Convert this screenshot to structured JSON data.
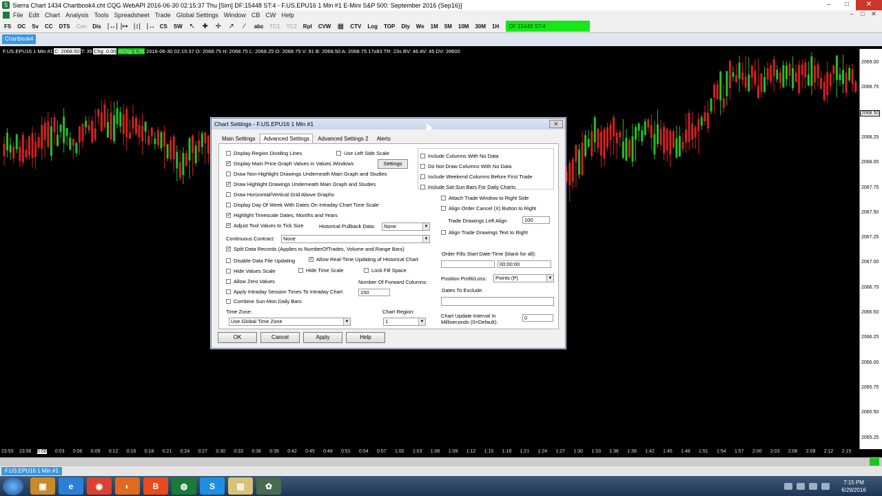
{
  "window": {
    "title": "Sierra Chart 1434 Chartbook4.cht  CQG WebAPI 2016-06-30  02:15:37 Thu [Sim]  DF:15448  ST:4 - F.US.EPU16  1 Min  #1  E-Mini S&P 500: September 2016 (Sep16)]",
    "min": "–",
    "max": "□",
    "close": "✕"
  },
  "menu": [
    "File",
    "Edit",
    "Chart",
    "Analysis",
    "Tools",
    "Spreadsheet",
    "Trade",
    "Global Settings",
    "Window",
    "CB",
    "CW",
    "Help"
  ],
  "mdi_controls": [
    "–",
    "□",
    "✕"
  ],
  "toolbar": {
    "items": [
      "FS",
      "OC",
      "Sv",
      "CC",
      "DTS",
      "Con",
      "Dis"
    ],
    "tools": [
      "|↔|",
      "|↦",
      "|↕|",
      "|↔",
      "CS",
      "SW"
    ],
    "cursors": [
      "↖",
      "✚",
      "✛",
      "↗",
      "⁄"
    ],
    "text_items": [
      "abc",
      "TC1",
      "TC2",
      "Rpl",
      "CVW",
      "▦",
      "CTV",
      "Log",
      "TOP",
      "Dly",
      "We",
      "1M",
      "5M",
      "10M",
      "30M",
      "1H"
    ],
    "status": "DF:15449  ST:4"
  },
  "chartbook_tab": "Chartbook4",
  "chart": {
    "info": {
      "symbol": "F.US.EPU16  1 Min  #1",
      "c_box": "C: 2068.50",
      "t": "T: 39",
      "chg": "Chg: 0.00",
      "pchg": "0Chg: 1.75",
      "rest": "2016-06-30  02:15:37 O: 2068.75  H: 2068.75  L: 2068.25  O: 2068.75  V: 91  B: 2068.50  A: 2068.75  17x83  TR: 23s  BV: 46  AV: 45  DV: 39600"
    },
    "price_labels": [
      "2069.00",
      "2068.75",
      "2068.50",
      "2068.25",
      "2068.00",
      "2067.75",
      "2067.50",
      "2067.25",
      "2067.00",
      "2066.75",
      "2066.50",
      "2066.25",
      "2066.00",
      "2065.75",
      "2065.50",
      "2065.25"
    ],
    "highlight_price": "2068.50",
    "time_labels": [
      "23:53",
      "23:56",
      "0:00",
      "0:03",
      "0:06",
      "0:09",
      "0:12",
      "0:15",
      "0:18",
      "0:21",
      "0:24",
      "0:27",
      "0:30",
      "0:33",
      "0:36",
      "0:39",
      "0:42",
      "0:45",
      "0:48",
      "0:51",
      "0:54",
      "0:57",
      "1:00",
      "1:03",
      "1:06",
      "1:09",
      "1:12",
      "1:15",
      "1:18",
      "1:21",
      "1:24",
      "1:27",
      "1:30",
      "1:33",
      "1:36",
      "1:39",
      "1:42",
      "1:45",
      "1:48",
      "1:51",
      "1:54",
      "1:57",
      "2:00",
      "2:03",
      "2:06",
      "2:09",
      "2:12",
      "2:15"
    ],
    "highlight_time": "0:00",
    "up_color": "#22c322",
    "down_color": "#d42020"
  },
  "sheet_tab": "F.US.EPU16  1 Min  #1",
  "taskbar": {
    "apps": [
      "start-orb",
      "explorer",
      "ie",
      "chrome",
      "firefox",
      "brave",
      "globe",
      "skype",
      "files",
      "sierra"
    ],
    "clock_time": "7:15 PM",
    "clock_date": "6/29/2016"
  },
  "dialog": {
    "title": "Chart Settings - F.US.EPU16  1 Min  #1",
    "close": "✕",
    "tabs": [
      "Main Settings",
      "Advanced Settings",
      "Advanced Settings 2",
      "Alerts"
    ],
    "left_checks": [
      {
        "label": "Display Region Dividing Lines",
        "checked": false
      },
      {
        "label": "Display Main Price Graph Values in Values Windows",
        "checked": true
      },
      {
        "label": "Draw Non-Highlight Drawings Underneath Main Graph and Studies",
        "checked": false
      },
      {
        "label": "Draw Highlight Drawings Underneath Main Graph and Studies",
        "checked": true
      },
      {
        "label": "Draw Horizontal/Vertical Grid Above Graphs",
        "checked": false
      },
      {
        "label": "Display Day Of Week With Dates On Intraday Chart Time Scale",
        "checked": false
      },
      {
        "label": "Highlight Timescale Dates, Months and Years",
        "checked": true
      },
      {
        "label": "Adjust Tool Values to Tick Size",
        "checked": true
      }
    ],
    "use_left_side_scale": "Use Left Side Scale",
    "settings_button": "Settings",
    "historical_pullback_label": "Historical Pullback Data:",
    "historical_pullback_value": "None",
    "continuous_contract_label": "Continuous Contract:",
    "continuous_contract_value": "None",
    "split_data": "Split Data Records (Applies to NumberOfTrades, Volume and Range Bars)",
    "disable_file_updating": "Disable Data File Updating",
    "allow_realtime": "Allow Real-Time Updating of Historical Chart",
    "hide_values_scale": "Hide Values Scale",
    "hide_time_scale": "Hide Time Scale",
    "lock_fill_space": "Lock Fill Space",
    "allow_zero_values": "Allow Zero Values",
    "forward_columns_label": "Number Of Forward Columns:",
    "forward_columns_value": "150",
    "apply_intraday": "Apply Intraday Session Times To Intraday Chart",
    "combine_sun_mon": "Combine Sun-Mon Daily Bars",
    "time_zone_label": "Time Zone:",
    "time_zone_value": "Use Global Time Zone",
    "chart_region_label": "Chart Region:",
    "chart_region_value": "1",
    "right_group": [
      "Include Columns With No Data",
      "Do Not Draw Columns With No Data",
      "Include Weekend Columns Before First Trade",
      "Include Sat-Sun Bars For Daily Charts"
    ],
    "attach_trade_window": "Attach Trade Window to Right Side",
    "align_order_cancel": "Align Order Cancel (X) Button to Right",
    "trade_drawings_left_label": "Trade Drawings Left Align",
    "trade_drawings_left_value": "100",
    "align_trade_drawings_text": "Align Trade Drawings Text to Right",
    "order_fills_label": "Order Fills Start Date-Time (blank for all):",
    "order_fills_time": "00:00:00",
    "position_pl_label": "Position Profit/Loss:",
    "position_pl_value": "Points (P)",
    "dates_to_exclude_label": "Dates To Exclude:",
    "update_interval_label_1": "Chart Update Interval In",
    "update_interval_label_2": "Milliseconds (0=Default):",
    "update_interval_value": "0",
    "buttons": {
      "ok": "OK",
      "cancel": "Cancel",
      "apply": "Apply",
      "help": "Help"
    }
  }
}
